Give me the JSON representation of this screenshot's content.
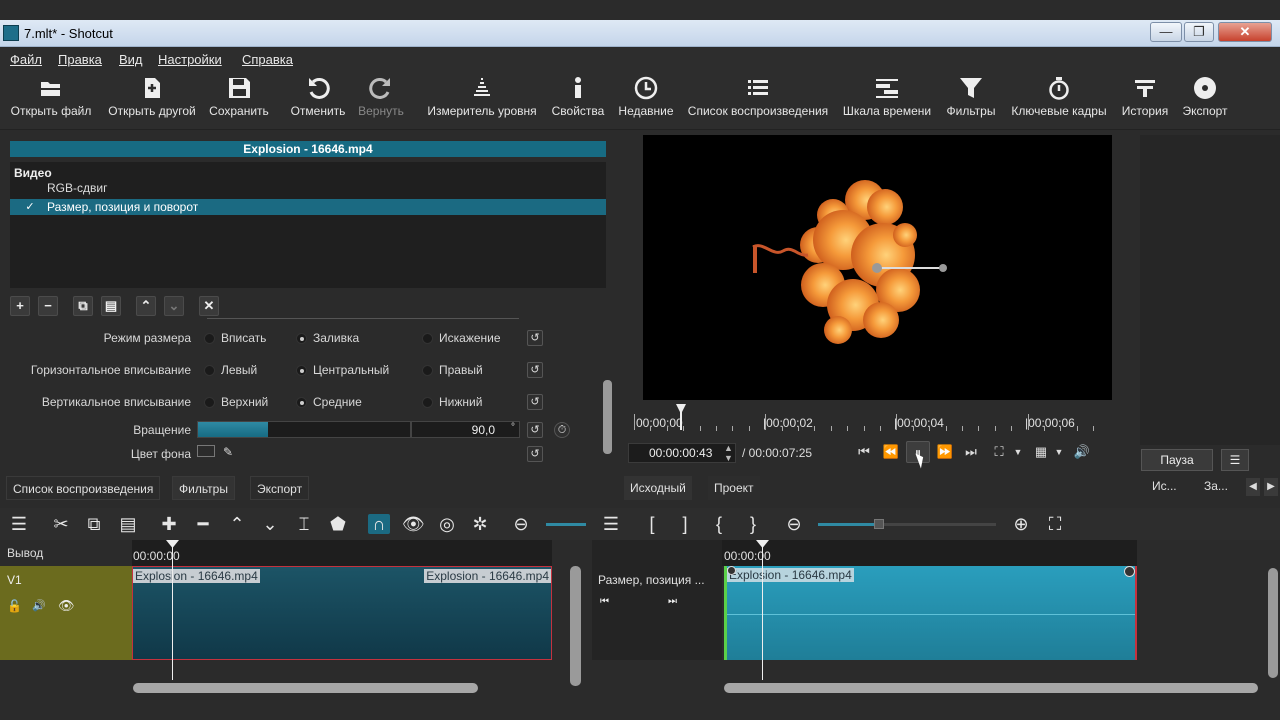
{
  "window": {
    "title": "7.mlt* - Shotcut",
    "min": "—",
    "max": "❐",
    "close": "✕"
  },
  "menu": [
    "Файл",
    "Правка",
    "Вид",
    "Настройки",
    "Справка"
  ],
  "toolbar": [
    {
      "label": "Открыть файл",
      "icon": "open-folder-icon"
    },
    {
      "label": "Открыть другой",
      "icon": "open-other-icon"
    },
    {
      "label": "Сохранить",
      "icon": "save-icon"
    },
    {
      "label": "Отменить",
      "icon": "undo-icon"
    },
    {
      "label": "Вернуть",
      "icon": "redo-icon",
      "disabled": true
    },
    {
      "label": "Измеритель уровня",
      "icon": "audio-meter-icon"
    },
    {
      "label": "Свойства",
      "icon": "info-icon"
    },
    {
      "label": "Недавние",
      "icon": "clock-icon"
    },
    {
      "label": "Список воспроизведения",
      "icon": "list-icon"
    },
    {
      "label": "Шкала времени",
      "icon": "timeline-icon"
    },
    {
      "label": "Фильтры",
      "icon": "funnel-icon"
    },
    {
      "label": "Ключевые кадры",
      "icon": "stopwatch-icon"
    },
    {
      "label": "История",
      "icon": "history-icon"
    },
    {
      "label": "Экспорт",
      "icon": "disc-icon"
    }
  ],
  "filters": {
    "clip_title": "Explosion - 16646.mp4",
    "category": "Видео",
    "items": [
      {
        "name": "RGB-сдвиг",
        "checked": false,
        "selected": false
      },
      {
        "name": "Размер, позиция и поворот",
        "checked": true,
        "selected": true
      }
    ],
    "buttons": [
      "+",
      "−",
      "⧉",
      "▤",
      "⌃",
      "⌄",
      "✕"
    ]
  },
  "props": {
    "size_mode": {
      "label": "Режим размера",
      "options": [
        "Вписать",
        "Заливка",
        "Искажение"
      ],
      "selected": 1
    },
    "h_fit": {
      "label": "Горизонтальное вписывание",
      "options": [
        "Левый",
        "Центральный",
        "Правый"
      ],
      "selected": 1
    },
    "v_fit": {
      "label": "Вертикальное вписывание",
      "options": [
        "Верхний",
        "Средние",
        "Нижний"
      ],
      "selected": 1
    },
    "rotation": {
      "label": "Вращение",
      "value": "90,0",
      "unit": "°",
      "fill": 0.33
    },
    "bg_color": {
      "label": "Цвет фона"
    }
  },
  "player": {
    "ruler": [
      "00:00:00",
      "|00:00:02",
      "|00:00:04",
      "|00:00:06"
    ],
    "current": "00:00:00:43",
    "total": "/ 00:00:07:25",
    "pause_button": "Пауза",
    "tabs": [
      "Исходный",
      "Проект"
    ]
  },
  "right_tabs": [
    "Ис...",
    "За..."
  ],
  "bottom_tabs": [
    "Список воспроизведения",
    "Фильтры",
    "Экспорт"
  ],
  "timeline": {
    "output_label": "Вывод",
    "track": "V1",
    "ruler_start": "00:00:00",
    "clip_labels": [
      "Explosion - 16646.mp4",
      "Explosion - 16646.mp4"
    ]
  },
  "keyframes": {
    "filter_label": "Размер, позиция ...",
    "ruler_start": "00:00:00",
    "clip_label": "Explosion - 16646.mp4"
  },
  "colors": {
    "accent": "#176b83",
    "clip": "#1f7e98",
    "track": "#6b6b1e",
    "selected_border": "#c4323e"
  }
}
